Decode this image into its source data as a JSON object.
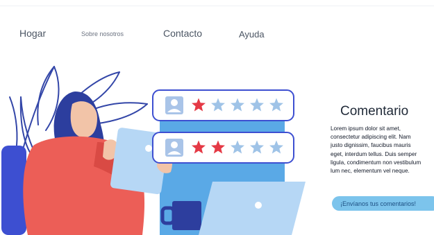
{
  "nav": {
    "home": "Hogar",
    "about": "Sobre nosotros",
    "contact": "Contacto",
    "help": "Ayuda"
  },
  "panel": {
    "title": "Comentario",
    "body": "Lorem ipsum dolor sit amet,\nconsectetur adipiscing elit. Nam\njusto dignissim, faucibus mauris\neget, interdum tellus. Duis semper\nligula, condimentum non vestibulum\nlum nec, elementum vel neque.",
    "button": "¡Envíanos tus comentarios!"
  },
  "reviews": [
    {
      "rating": 1,
      "out_of": 5
    },
    {
      "rating": 2,
      "out_of": 5
    }
  ],
  "colors": {
    "star_filled": "#e53945",
    "star_empty": "#9fc3e7",
    "blob": "#5aa9e6",
    "button": "#7cc4ec",
    "shirt": "#ec5e57",
    "hair": "#2c3e9e"
  },
  "icons": [
    "user-avatar-icon",
    "star-icon",
    "tablet-icon",
    "laptop-icon",
    "mug-icon",
    "leaf-icon"
  ]
}
